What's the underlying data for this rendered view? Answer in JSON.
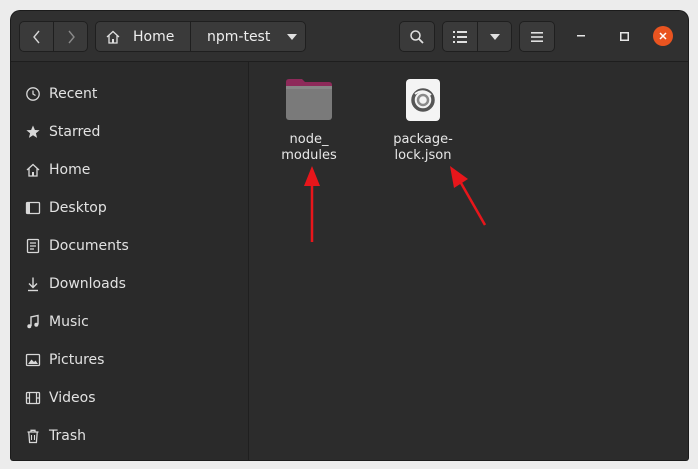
{
  "header": {
    "path": [
      "Home",
      "npm-test"
    ]
  },
  "sidebar": {
    "items": [
      {
        "label": "Recent",
        "icon": "clock-icon"
      },
      {
        "label": "Starred",
        "icon": "star-icon"
      },
      {
        "label": "Home",
        "icon": "home-icon"
      },
      {
        "label": "Desktop",
        "icon": "desktop-icon"
      },
      {
        "label": "Documents",
        "icon": "documents-icon"
      },
      {
        "label": "Downloads",
        "icon": "downloads-icon"
      },
      {
        "label": "Music",
        "icon": "music-icon"
      },
      {
        "label": "Pictures",
        "icon": "pictures-icon"
      },
      {
        "label": "Videos",
        "icon": "videos-icon"
      },
      {
        "label": "Trash",
        "icon": "trash-icon"
      }
    ]
  },
  "files": [
    {
      "name": "node_\nmodules",
      "icon": "folder-icon"
    },
    {
      "name": "package-\nlock.json",
      "icon": "json-file-icon"
    }
  ],
  "colors": {
    "close_button": "#e95420",
    "annotation_arrow": "#e8161b",
    "folder": "#7a7a7a",
    "folder_tab": "#8e2a5a"
  }
}
